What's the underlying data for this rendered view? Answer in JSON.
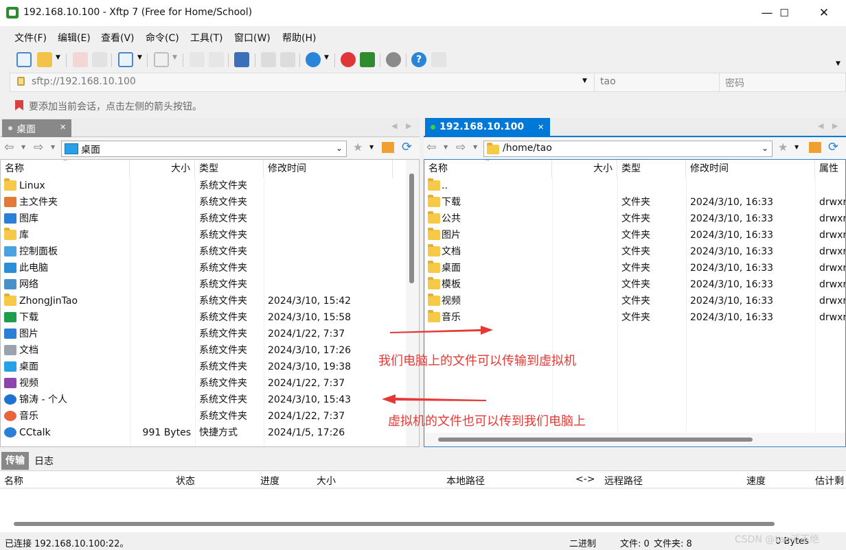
{
  "window": {
    "title": "192.168.10.100 - Xftp 7 (Free for Home/School)",
    "minimize": "—",
    "maximize": "☐",
    "close": "✕"
  },
  "menu": [
    "文件(F)",
    "编辑(E)",
    "查看(V)",
    "命令(C)",
    "工具(T)",
    "窗口(W)",
    "帮助(H)"
  ],
  "address": {
    "url": "sftp://192.168.10.100",
    "username": "tao",
    "password_placeholder": "密码"
  },
  "hint": "要添加当前会话，点击左侧的箭头按钮。",
  "left_tab": {
    "label": "桌面"
  },
  "right_tab": {
    "label": "192.168.10.100"
  },
  "left_pane": {
    "path": "桌面",
    "columns": [
      "名称",
      "大小",
      "类型",
      "修改时间"
    ],
    "rows": [
      {
        "name": "Linux",
        "size": "",
        "type": "系统文件夹",
        "modified": "",
        "icon": "folder"
      },
      {
        "name": "主文件夹",
        "size": "",
        "type": "系统文件夹",
        "modified": "",
        "icon": "home"
      },
      {
        "name": "图库",
        "size": "",
        "type": "系统文件夹",
        "modified": "",
        "icon": "gallery"
      },
      {
        "name": "库",
        "size": "",
        "type": "系统文件夹",
        "modified": "",
        "icon": "folder"
      },
      {
        "name": "控制面板",
        "size": "",
        "type": "系统文件夹",
        "modified": "",
        "icon": "control-panel"
      },
      {
        "name": "此电脑",
        "size": "",
        "type": "系统文件夹",
        "modified": "",
        "icon": "computer"
      },
      {
        "name": "网络",
        "size": "",
        "type": "系统文件夹",
        "modified": "",
        "icon": "network"
      },
      {
        "name": "ZhongJinTao",
        "size": "",
        "type": "系统文件夹",
        "modified": "2024/3/10, 15:42",
        "icon": "folder"
      },
      {
        "name": "下载",
        "size": "",
        "type": "系统文件夹",
        "modified": "2024/3/10, 15:58",
        "icon": "download"
      },
      {
        "name": "图片",
        "size": "",
        "type": "系统文件夹",
        "modified": "2024/1/22, 7:37",
        "icon": "picture"
      },
      {
        "name": "文档",
        "size": "",
        "type": "系统文件夹",
        "modified": "2024/3/10, 17:26",
        "icon": "document"
      },
      {
        "name": "桌面",
        "size": "",
        "type": "系统文件夹",
        "modified": "2024/3/10, 19:38",
        "icon": "desktop"
      },
      {
        "name": "视频",
        "size": "",
        "type": "系统文件夹",
        "modified": "2024/1/22, 7:37",
        "icon": "video"
      },
      {
        "name": "锦涛 - 个人",
        "size": "",
        "type": "系统文件夹",
        "modified": "2024/3/10, 15:43",
        "icon": "cloud"
      },
      {
        "name": "音乐",
        "size": "",
        "type": "系统文件夹",
        "modified": "2024/1/22, 7:37",
        "icon": "music"
      },
      {
        "name": "CCtalk",
        "size": "991 Bytes",
        "type": "快捷方式",
        "modified": "2024/1/5, 17:26",
        "icon": "cctalk"
      }
    ]
  },
  "right_pane": {
    "path": "/home/tao",
    "columns": [
      "名称",
      "大小",
      "类型",
      "修改时间",
      "属性"
    ],
    "rows": [
      {
        "name": "..",
        "size": "",
        "type": "",
        "modified": "",
        "attr": ""
      },
      {
        "name": "下载",
        "size": "",
        "type": "文件夹",
        "modified": "2024/3/10, 16:33",
        "attr": "drwxr"
      },
      {
        "name": "公共",
        "size": "",
        "type": "文件夹",
        "modified": "2024/3/10, 16:33",
        "attr": "drwxr"
      },
      {
        "name": "图片",
        "size": "",
        "type": "文件夹",
        "modified": "2024/3/10, 16:33",
        "attr": "drwxr"
      },
      {
        "name": "文档",
        "size": "",
        "type": "文件夹",
        "modified": "2024/3/10, 16:33",
        "attr": "drwxr"
      },
      {
        "name": "桌面",
        "size": "",
        "type": "文件夹",
        "modified": "2024/3/10, 16:33",
        "attr": "drwxr"
      },
      {
        "name": "模板",
        "size": "",
        "type": "文件夹",
        "modified": "2024/3/10, 16:33",
        "attr": "drwxr"
      },
      {
        "name": "视频",
        "size": "",
        "type": "文件夹",
        "modified": "2024/3/10, 16:33",
        "attr": "drwxr"
      },
      {
        "name": "音乐",
        "size": "",
        "type": "文件夹",
        "modified": "2024/3/10, 16:33",
        "attr": "drwxr"
      }
    ]
  },
  "annotations": {
    "upload": "我们电脑上的文件可以传输到虚拟机",
    "download": "虚拟机的文件也可以传到我们电脑上"
  },
  "bottom": {
    "tabs": [
      "传输",
      "日志"
    ],
    "columns": [
      "名称",
      "状态",
      "进度",
      "大小",
      "本地路径",
      "<->",
      "远程路径",
      "速度",
      "估计剩"
    ]
  },
  "status": {
    "connection": "已连接 192.168.10.100:22。",
    "mode": "二进制",
    "files": "文件: 0",
    "folders": "文件夹: 8",
    "bytes": "0 Bytes",
    "watermark": "CSDN @tao滔不绝"
  }
}
